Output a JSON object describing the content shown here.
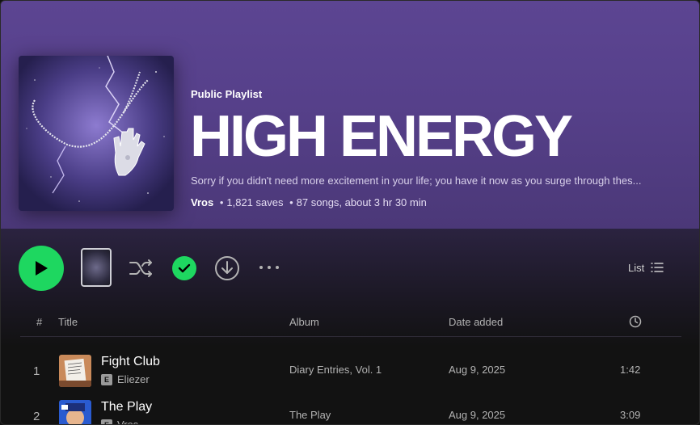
{
  "playlist": {
    "type_label": "Public Playlist",
    "title": "HIGH ENERGY",
    "description": "Sorry if you didn't need more excitement in your life; you have it now as you surge through thes...",
    "owner": "Vros",
    "saves": "1,821 saves",
    "songs": "87 songs, about 3 hr 30 min",
    "separator": "•"
  },
  "actions": {
    "play_icon": "play-icon",
    "shuffle_icon": "shuffle-icon",
    "saved_icon": "check-icon",
    "download_icon": "download-icon",
    "more_icon": "more-icon",
    "view_label": "List",
    "view_icon": "list-icon"
  },
  "columns": {
    "number": "#",
    "title": "Title",
    "album": "Album",
    "date_added": "Date added",
    "duration_icon": "clock-icon"
  },
  "tracks": [
    {
      "number": "1",
      "name": "Fight Club",
      "explicit": "E",
      "artist": "Eliezer",
      "album": "Diary Entries, Vol. 1",
      "date_added": "Aug 9, 2025",
      "duration": "1:42"
    },
    {
      "number": "2",
      "name": "The Play",
      "explicit": "E",
      "artist": "Vros",
      "album": "The Play",
      "date_added": "Aug 9, 2025",
      "duration": "3:09"
    }
  ],
  "colors": {
    "accent": "#1ed760",
    "header_purple": "#5c4592",
    "background": "#121212"
  }
}
